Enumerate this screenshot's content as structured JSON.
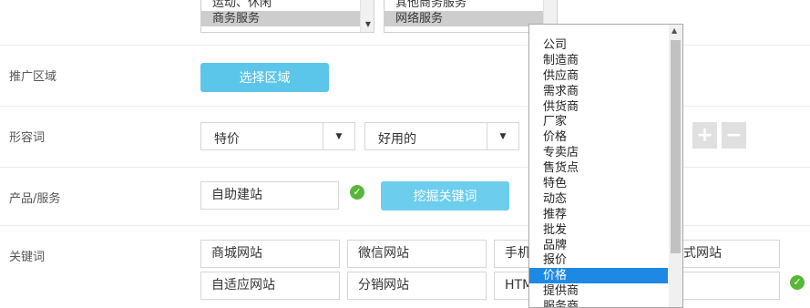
{
  "industry": {
    "left_options": [
      "运动、休闲",
      "商务服务"
    ],
    "left_selected": 1,
    "right_options": [
      "其他商务服务",
      "网络服务"
    ],
    "right_selected": 1
  },
  "region": {
    "label": "推广区域",
    "button": "选择区域"
  },
  "adjectives": {
    "label": "形容词",
    "select1": "特价",
    "select2": "好用的",
    "add": "+",
    "remove": "−"
  },
  "product": {
    "label": "产品/服务",
    "value": "自助建站",
    "button": "挖掘关键词"
  },
  "keywords": {
    "label": "关键词",
    "row1": [
      "商城网站",
      "微信网站",
      "手机",
      "式网站"
    ],
    "row2": [
      "自适应网站",
      "分销网站",
      "HTM",
      ""
    ]
  },
  "dropdown": {
    "items": [
      "公司",
      "制造商",
      "供应商",
      "需求商",
      "供货商",
      "厂家",
      "价格",
      "专卖店",
      "售货点",
      "特色",
      "动态",
      "推荐",
      "批发",
      "品牌",
      "报价",
      "价格",
      "提供商",
      "服务商"
    ],
    "highlighted_index": 15
  },
  "colors": {
    "primary_button": "#5bc6e9",
    "highlight": "#1e88e5",
    "check": "#58b63a"
  }
}
